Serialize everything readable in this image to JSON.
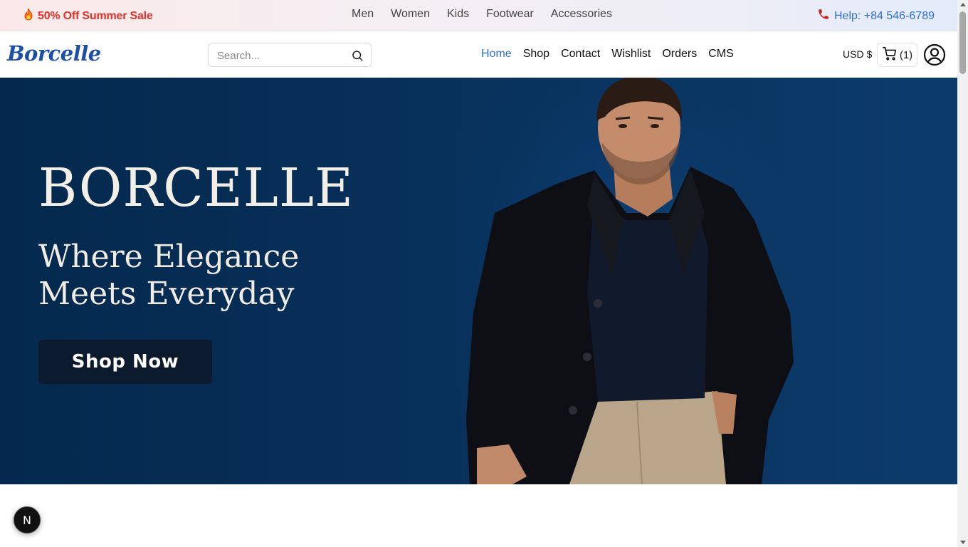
{
  "topbar": {
    "promo_icon": "fire-icon",
    "promo_text": "50% Off Summer Sale",
    "categories": [
      "Men",
      "Women",
      "Kids",
      "Footwear",
      "Accessories"
    ],
    "help_icon": "phone-icon",
    "help_text": "Help: +84 546-6789"
  },
  "header": {
    "logo": "Borcelle",
    "search_placeholder": "Search...",
    "nav": [
      {
        "label": "Home",
        "active": true
      },
      {
        "label": "Shop",
        "active": false
      },
      {
        "label": "Contact",
        "active": false
      },
      {
        "label": "Wishlist",
        "active": false
      },
      {
        "label": "Orders",
        "active": false
      },
      {
        "label": "CMS",
        "active": false
      }
    ],
    "currency": "USD $",
    "cart_count": "(1)",
    "icons": {
      "search": "search-icon",
      "cart": "cart-icon",
      "account": "user-circle-icon"
    }
  },
  "hero": {
    "brand": "BORCELLE",
    "tagline_line1": "Where Elegance",
    "tagline_line2": "Meets Everyday",
    "cta": "Shop Now"
  },
  "dev_badge": "N",
  "colors": {
    "promo": "#e0332b",
    "link": "#2f6fd6",
    "logo": "#1d4fa6",
    "hero_bg": "#07305a",
    "cta_bg": "#0c1a2e"
  }
}
